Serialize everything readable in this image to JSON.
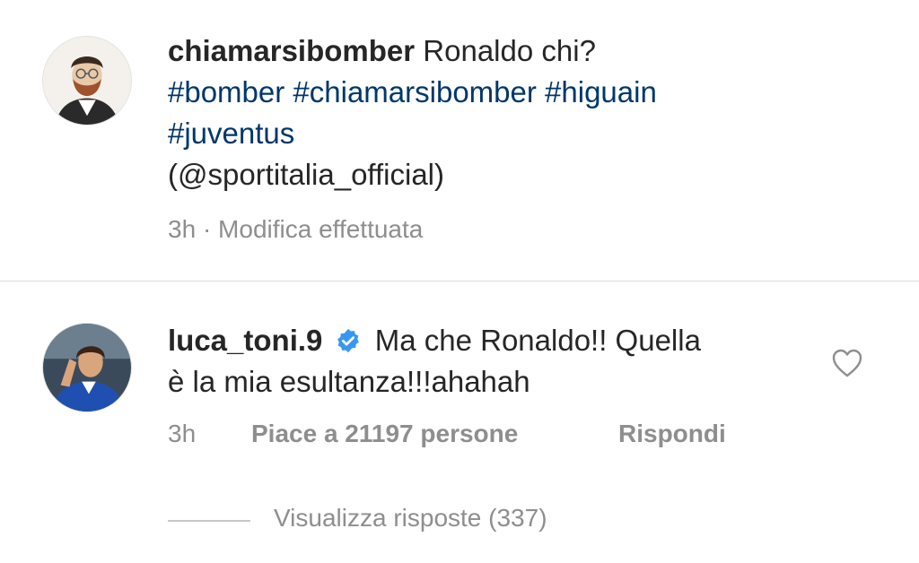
{
  "caption": {
    "username": "chiamarsibomber",
    "text": "Ronaldo chi?",
    "hashtags_line1": "#bomber #chiamarsibomber #higuain",
    "hashtags_line2": "#juventus",
    "mention_line": "(@sportitalia_official)",
    "time": "3h",
    "separator": "·",
    "edited_label": "Modifica effettuata"
  },
  "comment": {
    "username": "luca_toni.9",
    "verified": true,
    "text_line1": "Ma che Ronaldo!! Quella",
    "text_line2": "è la mia esultanza!!!ahahah",
    "time": "3h",
    "likes_label": "Piace a 21197 persone",
    "reply_label": "Rispondi",
    "view_replies_label": "Visualizza risposte (337)"
  },
  "colors": {
    "text": "#262626",
    "hashtag": "#00376b",
    "meta": "#8e8e8e",
    "verified_badge": "#3897f0",
    "divider": "#dbdbdb"
  },
  "icons": {
    "avatar1": "bearded-man-illustration-avatar",
    "avatar2": "football-player-photo-avatar",
    "verified": "verified-badge-icon",
    "like": "heart-outline-icon"
  }
}
